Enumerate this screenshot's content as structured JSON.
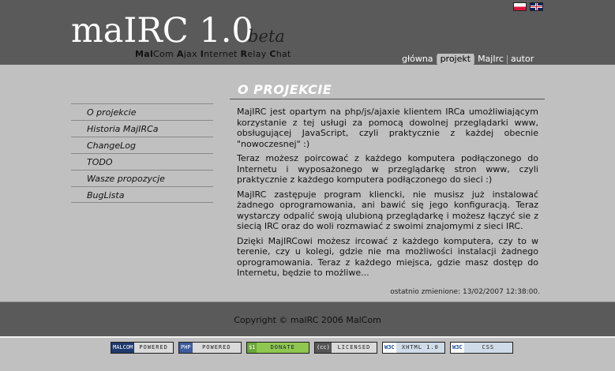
{
  "header": {
    "title": "maIRC 1.0",
    "beta": "beta",
    "subtitle_parts": [
      {
        "bold": "Mal",
        "rest": "Com "
      },
      {
        "bold": "A",
        "rest": "jax "
      },
      {
        "bold": "I",
        "rest": "nternet "
      },
      {
        "bold": "R",
        "rest": "elay "
      },
      {
        "bold": "C",
        "rest": "hat"
      }
    ],
    "flags": [
      "flag-pl-icon",
      "flag-en-icon"
    ]
  },
  "nav": {
    "items": [
      {
        "label": "główna",
        "active": false
      },
      {
        "label": "projekt",
        "active": true
      },
      {
        "label": "MajIrc",
        "active": false
      },
      {
        "label": "autor",
        "active": false
      }
    ]
  },
  "sidebar": {
    "items": [
      {
        "label": "O projekcie"
      },
      {
        "label": "Historia MajIRCa"
      },
      {
        "label": "ChangeLog"
      },
      {
        "label": "TODO"
      },
      {
        "label": "Wasze propozycje"
      },
      {
        "label": "BugLista"
      }
    ]
  },
  "content": {
    "title": "O PROJEKCIE",
    "paragraphs": [
      "MajIRC jest opartym na php/js/ajaxie klientem IRCa umożliwiającym korzystanie z tej usługi za pomocą dowolnej przeglądarki www, obsługującej JavaScript, czyli praktycznie z każdej obecnie \"nowoczesnej\" :)",
      "Teraz możesz poircować z każdego komputera podłączonego do Internetu i wyposażonego w przeglądarkę stron www, czyli praktycznie z każdego komputera podłączonego do sieci :)",
      "MajIRC zastępuje program kliencki, nie musisz już instalować żadnego oprogramowania, ani bawić się jego konfiguracją. Teraz wystarczy odpalić swoją ulubioną przeglądarkę i możesz łączyć sie z siecią IRC oraz do woli rozmawiać z swoimi znajomymi z sieci IRC.",
      "Dzięki MajIRCowi możesz ircować z każdego komputera, czy to w terenie, czy u kolegi, gdzie nie ma możliwości instalacji żadnego oprogramowania. Teraz z każdego miejsca, gdzie masz dostęp do Internetu, będzie to możliwe..."
    ],
    "modified": "ostatnio zmienione: 13/02/2007 12:38:00."
  },
  "footer": {
    "copyright": "Copyright © maIRC 2006 MalCom"
  },
  "badges": [
    {
      "left": "MALCOM",
      "right": "POWERED",
      "icon": "malcom-badge-icon"
    },
    {
      "left": "PHP",
      "right": "POWERED",
      "icon": "php-badge-icon"
    },
    {
      "left": "$1",
      "right": "DONATE",
      "icon": "donate-badge-icon"
    },
    {
      "left": "(cc)",
      "right": "LICENSED",
      "icon": "cc-badge-icon"
    },
    {
      "left": "W3C",
      "right": "XHTML 1.0",
      "icon": "w3c-xhtml-badge-icon"
    },
    {
      "left": "W3C",
      "right": "CSS",
      "icon": "w3c-css-badge-icon"
    }
  ]
}
